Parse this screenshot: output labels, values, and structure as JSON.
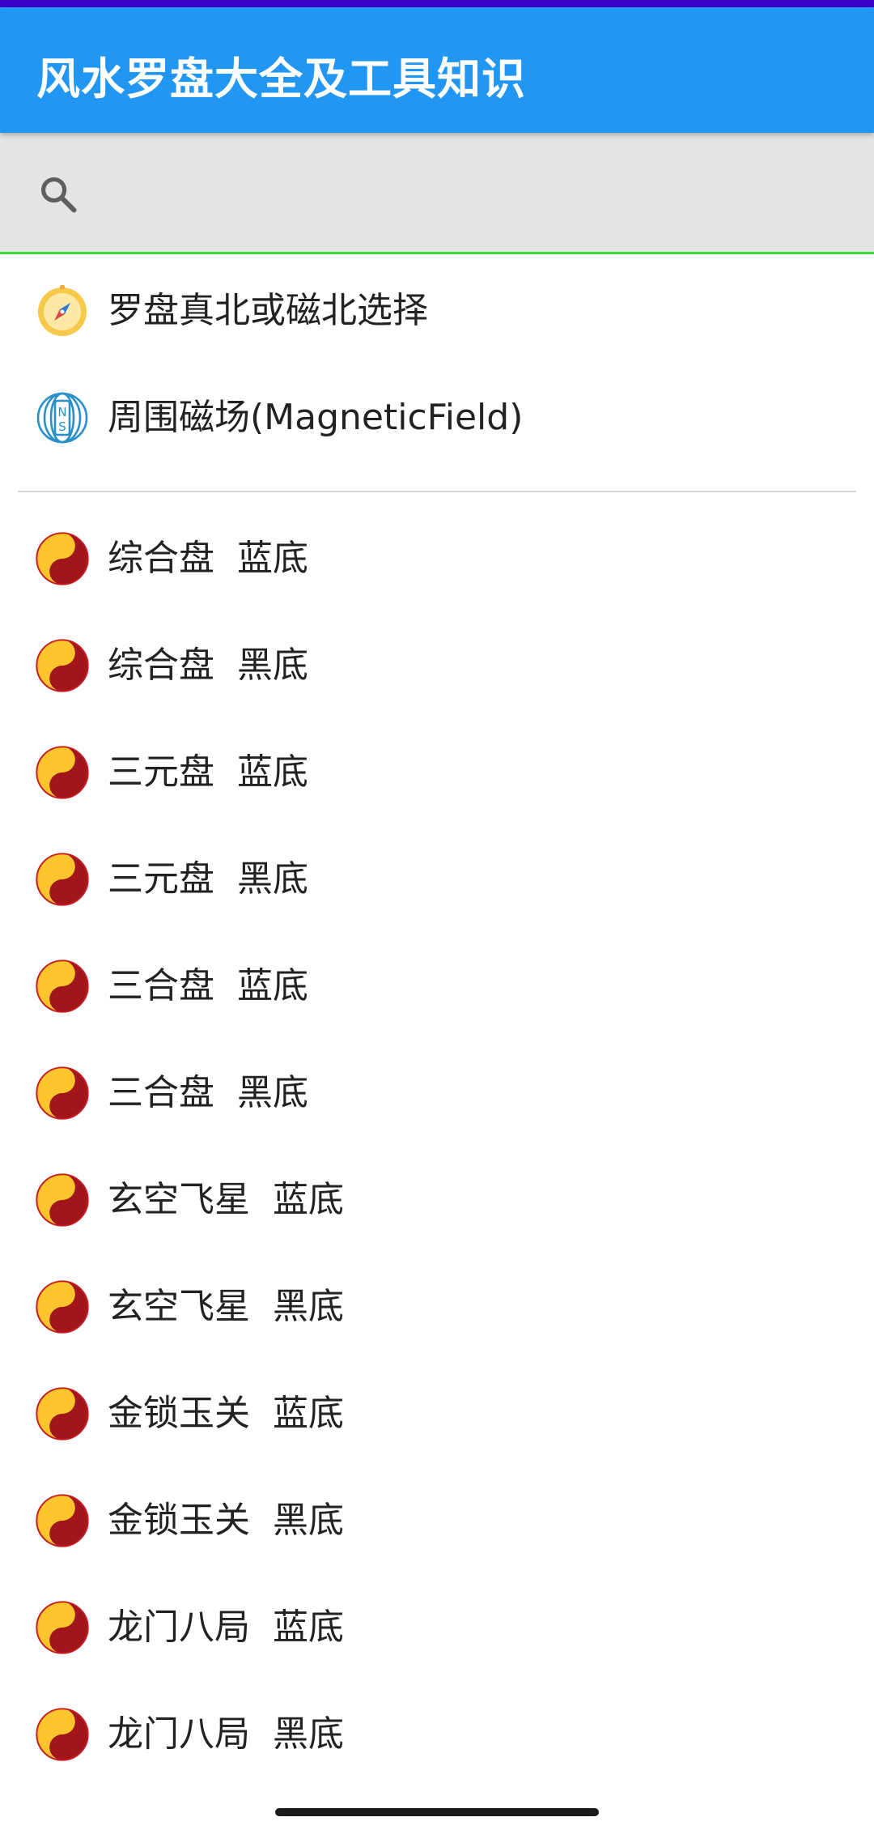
{
  "app": {
    "title": "风水罗盘大全及工具知识"
  },
  "search": {
    "placeholder": "",
    "value": ""
  },
  "tools": [
    {
      "label": "罗盘真北或磁北选择",
      "icon": "compass-icon"
    },
    {
      "label": "周围磁场(MagneticField)",
      "icon": "magnet-ns-icon"
    }
  ],
  "compasses": [
    {
      "label": "综合盘  蓝底",
      "icon": "yin-yang-icon"
    },
    {
      "label": "综合盘  黑底",
      "icon": "yin-yang-icon"
    },
    {
      "label": "三元盘  蓝底",
      "icon": "yin-yang-icon"
    },
    {
      "label": "三元盘  黑底",
      "icon": "yin-yang-icon"
    },
    {
      "label": "三合盘  蓝底",
      "icon": "yin-yang-icon"
    },
    {
      "label": "三合盘  黑底",
      "icon": "yin-yang-icon"
    },
    {
      "label": "玄空飞星  蓝底",
      "icon": "yin-yang-icon"
    },
    {
      "label": "玄空飞星  黑底",
      "icon": "yin-yang-icon"
    },
    {
      "label": "金锁玉关  蓝底",
      "icon": "yin-yang-icon"
    },
    {
      "label": "金锁玉关  黑底",
      "icon": "yin-yang-icon"
    },
    {
      "label": "龙门八局  蓝底",
      "icon": "yin-yang-icon"
    },
    {
      "label": "龙门八局  黑底",
      "icon": "yin-yang-icon"
    }
  ],
  "colors": {
    "app_bar": "#2196f3",
    "status_strip": "#3a00c8",
    "search_bg": "#e4e4e4",
    "search_underline": "#37dd37",
    "yin_yang_dark": "#a0161a",
    "yin_yang_light": "#fcc52b"
  }
}
